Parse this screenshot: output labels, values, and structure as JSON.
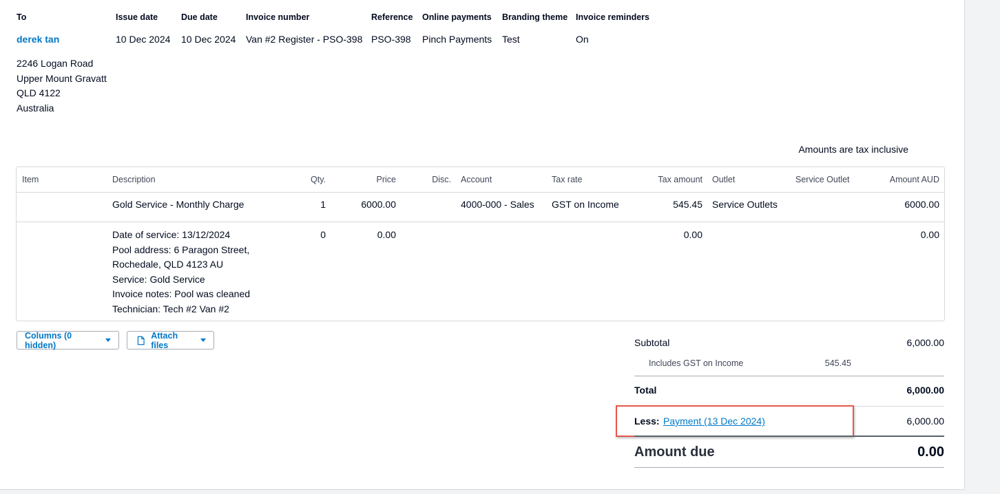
{
  "header": {
    "labels": [
      "To",
      "Issue date",
      "Due date",
      "Invoice number",
      "Reference",
      "Online payments",
      "Branding theme",
      "Invoice reminders"
    ],
    "contact": "derek tan",
    "issue_date": "10 Dec 2024",
    "due_date": "10 Dec 2024",
    "invoice_number": "Van #2 Register - PSO-398",
    "reference": "PSO-398",
    "online_payments": "Pinch Payments",
    "branding_theme": "Test",
    "invoice_reminders": "On"
  },
  "address": [
    "2246 Logan Road",
    "Upper Mount Gravatt",
    "QLD 4122",
    "Australia"
  ],
  "tax_note": "Amounts are tax inclusive",
  "table": {
    "columns": [
      "Item",
      "Description",
      "Qty.",
      "Price",
      "Disc.",
      "Account",
      "Tax rate",
      "Tax amount",
      "Outlet",
      "Service Outlet",
      "Amount AUD"
    ],
    "rows": [
      {
        "item": "",
        "description": [
          "Gold Service - Monthly Charge"
        ],
        "qty": "1",
        "price": "6000.00",
        "disc": "",
        "account": "4000-000 - Sales",
        "tax_rate": "GST on Income",
        "tax_amount": "545.45",
        "outlet": "Service Outlets",
        "service_outlet": "",
        "amount": "6000.00"
      },
      {
        "item": "",
        "description": [
          "Date of service: 13/12/2024",
          "Pool address: 6 Paragon Street,",
          "Rochedale, QLD 4123 AU",
          "Service: Gold Service",
          "Invoice notes: Pool was cleaned",
          "Technician: Tech #2 Van #2"
        ],
        "qty": "0",
        "price": "0.00",
        "disc": "",
        "account": "",
        "tax_rate": "",
        "tax_amount": "0.00",
        "outlet": "",
        "service_outlet": "",
        "amount": "0.00"
      }
    ]
  },
  "buttons": {
    "columns": "Columns (0 hidden)",
    "attach": "Attach files"
  },
  "totals": {
    "subtotal_label": "Subtotal",
    "subtotal": "6,000.00",
    "gst_label": "Includes GST on Income",
    "gst": "545.45",
    "total_label": "Total",
    "total": "6,000.00",
    "less_label": "Less:",
    "payment_link": "Payment (13 Dec 2024)",
    "payment_amount": "6,000.00",
    "amount_due_label": "Amount due",
    "amount_due": "0.00"
  },
  "colors": {
    "link": "#0078c8",
    "highlight": "#e8574b",
    "border": "#d5d8dc"
  },
  "icons": {
    "attach": "document-icon",
    "dropdown": "caret-down-icon"
  }
}
